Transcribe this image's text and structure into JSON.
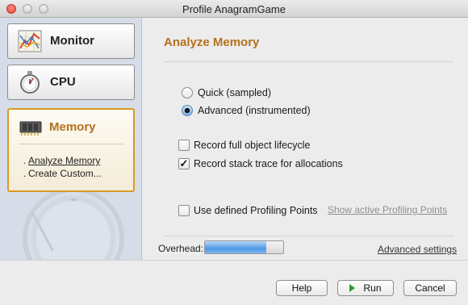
{
  "window": {
    "title": "Profile AnagramGame"
  },
  "sidebar": {
    "items": [
      {
        "label": "Monitor",
        "icon": "monitor-graph-icon"
      },
      {
        "label": "CPU",
        "icon": "stopwatch-icon"
      },
      {
        "label": "Memory",
        "icon": "memory-chip-icon",
        "selected": true
      }
    ],
    "memory_links": [
      "Analyze Memory",
      "Create Custom..."
    ]
  },
  "main": {
    "heading": "Analyze Memory",
    "modes": [
      {
        "label": "Quick (sampled)",
        "checked": false
      },
      {
        "label": "Advanced (instrumented)",
        "checked": true
      }
    ],
    "options": [
      {
        "label": "Record full object lifecycle",
        "checked": false
      },
      {
        "label": "Record stack trace for allocations",
        "checked": true
      }
    ],
    "profiling_points": {
      "label": "Use defined Profiling Points",
      "checked": false,
      "link": "Show active Profiling Points"
    },
    "overhead": {
      "label": "Overhead:",
      "level": 0.78
    },
    "advanced_settings_link": "Advanced settings"
  },
  "footer": {
    "help": "Help",
    "run": "Run",
    "cancel": "Cancel"
  },
  "colors": {
    "accent": "#b5701d",
    "selected_border": "#d99a22",
    "sidebar_bg": "#d6dde8",
    "progress": "#4f98e4"
  }
}
